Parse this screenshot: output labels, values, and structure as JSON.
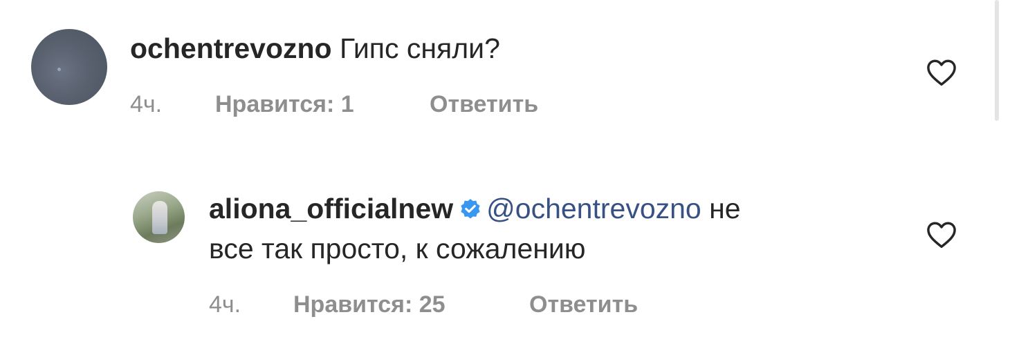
{
  "comments": [
    {
      "username": "ochentrevozno",
      "text": "Гипс сняли?",
      "time": "4ч.",
      "likes": "Нравится: 1",
      "reply": "Ответить",
      "avatar_icon": "avatar-photo-dark-sky",
      "like_icon": "heart-outline-icon"
    },
    {
      "username": "aliona_officialnew",
      "verified": true,
      "mention": "@ochentrevozno",
      "text_line1": "не",
      "text_line2": "все так просто, к сожалению",
      "time": "4ч.",
      "likes": "Нравится: 25",
      "reply": "Ответить",
      "avatar_icon": "avatar-photo-person-outdoors",
      "like_icon": "heart-outline-icon"
    }
  ],
  "colors": {
    "text": "#262626",
    "meta": "#8e8e8e",
    "mention": "#385185",
    "verified_badge": "#3897f0"
  }
}
